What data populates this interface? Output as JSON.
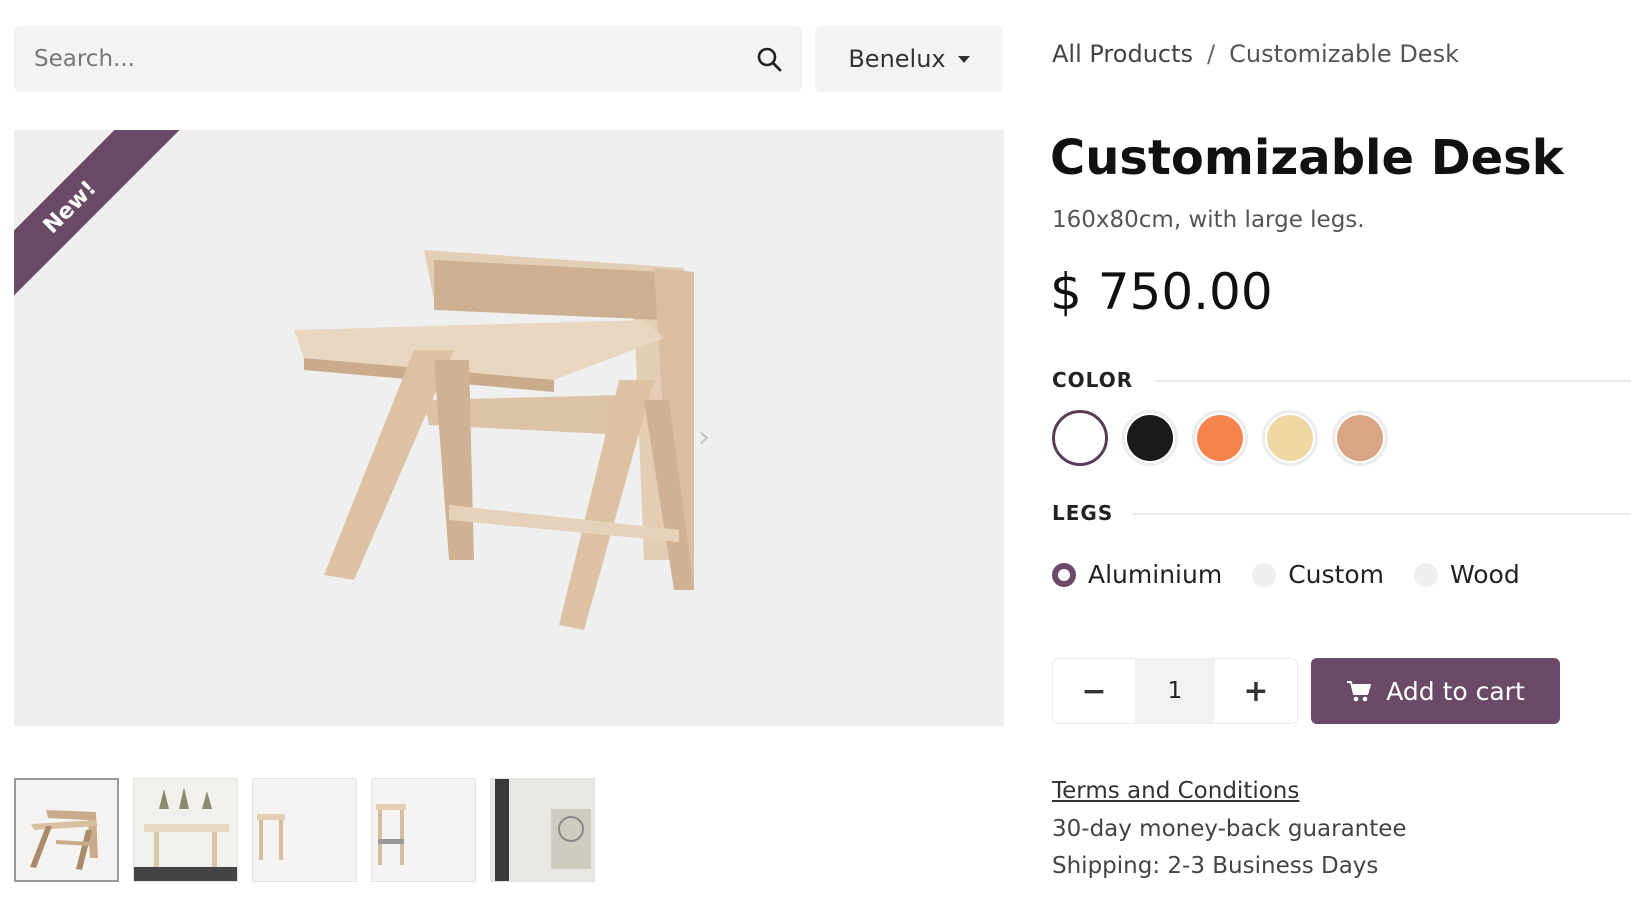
{
  "search": {
    "placeholder": "Search..."
  },
  "pricelist": {
    "label": "Benelux"
  },
  "breadcrumb": {
    "root": "All Products",
    "separator": "/",
    "current": "Customizable Desk"
  },
  "product": {
    "ribbon": "New!",
    "title": "Customizable Desk",
    "description": "160x80cm, with large legs.",
    "price": "$ 750.00"
  },
  "color": {
    "label": "COLOR",
    "swatches": [
      "#ffffff",
      "#1a1a1a",
      "#f4834c",
      "#efd7a4",
      "#d9a584"
    ],
    "selected_index": 0
  },
  "legs": {
    "label": "LEGS",
    "options": [
      "Aluminium",
      "Custom",
      "Wood"
    ],
    "selected_index": 0
  },
  "quantity": {
    "value": "1",
    "minus": "−",
    "plus": "+"
  },
  "cart": {
    "label": "Add to cart"
  },
  "footer": {
    "terms": "Terms and Conditions",
    "guarantee": "30-day money-back guarantee",
    "shipping": "Shipping: 2-3 Business Days"
  },
  "colors": {
    "accent": "#6b4a68",
    "panel": "#f3f3f3"
  },
  "thumbnails": [
    "desk-thumb",
    "dining-thumb",
    "chair-thumb",
    "chair-side-thumb",
    "room-thumb"
  ]
}
